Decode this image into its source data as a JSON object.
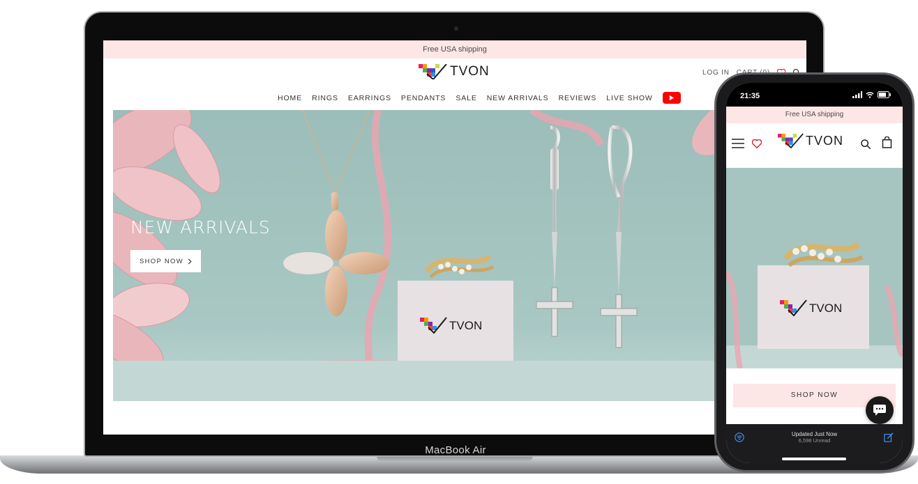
{
  "colors": {
    "announce_bg": "#fde6e6",
    "hero_bg": "#a3c4c0",
    "youtube_red": "#ff0000",
    "heart_red": "#e0273b"
  },
  "desktop": {
    "announcement": "Free USA shipping",
    "logo_text": "TVON",
    "util": {
      "login": "LOG IN",
      "cart": "CART (0)"
    },
    "nav": [
      "HOME",
      "RINGS",
      "EARRINGS",
      "PENDANTS",
      "SALE",
      "NEW ARRIVALS",
      "REVIEWS",
      "LIVE SHOW"
    ],
    "hero": {
      "title": "NEW ARRIVALS",
      "cta": "SHOP NOW",
      "product_logo": "TVON"
    }
  },
  "laptop_label": "MacBook Air",
  "phone": {
    "time": "21:35",
    "announcement": "Free USA shipping",
    "logo_text": "TVON",
    "hero_logo": "TVON",
    "cta": "SHOP NOW",
    "bottom": {
      "updated": "Updated Just Now",
      "unread": "6,598 Unread"
    }
  },
  "icons": [
    "search-icon",
    "heart-icon",
    "bag-icon",
    "hamburger-icon",
    "youtube-icon",
    "chevron-right-icon",
    "chat-icon",
    "compose-icon",
    "filter-icon",
    "wifi-icon",
    "battery-icon",
    "signal-icon"
  ]
}
